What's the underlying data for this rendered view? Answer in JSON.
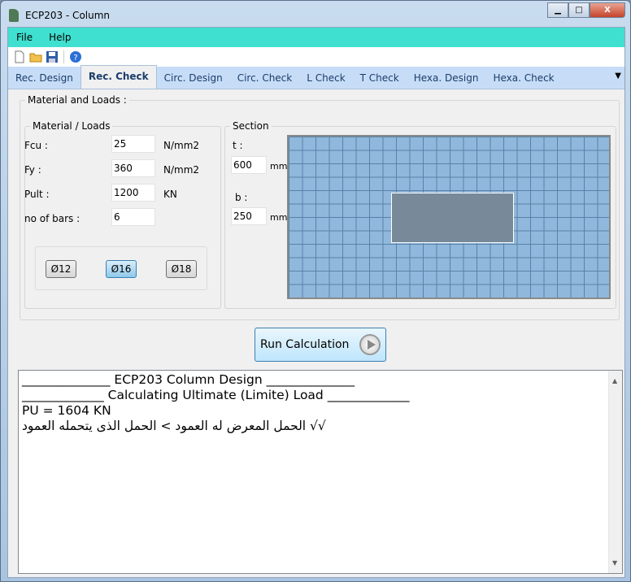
{
  "window": {
    "title": "ECP203 - Column",
    "minimize": "▁",
    "maximize": "□",
    "close": "X"
  },
  "menu": [
    "File",
    "Help"
  ],
  "toolbar": {
    "icons": [
      "new-file-icon",
      "open-folder-icon",
      "save-icon",
      "help-icon"
    ]
  },
  "tabs": [
    {
      "label": "Rec. Design"
    },
    {
      "label": "Rec. Check",
      "active": true
    },
    {
      "label": "Circ. Design"
    },
    {
      "label": "Circ. Check"
    },
    {
      "label": "L Check"
    },
    {
      "label": "T Check"
    },
    {
      "label": "Hexa. Design"
    },
    {
      "label": "Hexa. Check"
    }
  ],
  "tab_overflow": "▼",
  "group": {
    "title": "Material and Loads :",
    "material": {
      "title": "Material / Loads",
      "fcu": {
        "label": "Fcu :",
        "value": "25",
        "unit": "N/mm2"
      },
      "fy": {
        "label": "Fy :",
        "value": "360",
        "unit": "N/mm2"
      },
      "pult": {
        "label": "Pult :",
        "value": "1200",
        "unit": "KN"
      },
      "bars": {
        "label": "no of bars :",
        "value": "6"
      },
      "diameters": [
        {
          "label": "Ø12"
        },
        {
          "label": "Ø16",
          "selected": true
        },
        {
          "label": "Ø18"
        }
      ]
    },
    "section": {
      "title": "Section",
      "t": {
        "label": "t :",
        "value": "600",
        "unit": "mm"
      },
      "b": {
        "label": "b :",
        "value": "250",
        "unit": "mm"
      }
    }
  },
  "run_button": "Run Calculation",
  "output": {
    "lines": [
      "______________ ECP203 Column Design ______________",
      "",
      "_____________ Calculating Ultimate (Limite) Load _____________",
      "",
      "PU = 1604 KN",
      "√√ الحمل المعرض له العمود > الحمل الذى يتحمله العمود"
    ]
  },
  "colors": {
    "menubar": "#40e0d0",
    "tabstrip": "#c7ddf7",
    "section_grid": "#90b8dc",
    "section_rect": "#788a99"
  }
}
